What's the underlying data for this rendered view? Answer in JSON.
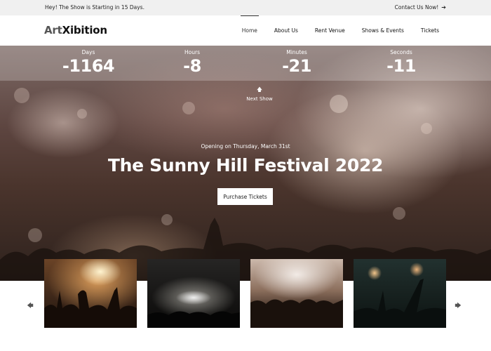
{
  "topbar": {
    "announcement": "Hey! The Show is Starting in 15 Days.",
    "contact_label": "Contact Us Now!",
    "contact_icon": "arrow-right-icon"
  },
  "header": {
    "logo_part1": "Art",
    "logo_part2": "Xibition",
    "nav": [
      {
        "label": "Home",
        "active": true
      },
      {
        "label": "About Us",
        "active": false
      },
      {
        "label": "Rent Venue",
        "active": false
      },
      {
        "label": "Shows & Events",
        "active": false
      },
      {
        "label": "Tickets",
        "active": false
      }
    ]
  },
  "countdown": [
    {
      "label": "Days",
      "value": "-1164"
    },
    {
      "label": "Hours",
      "value": "-8"
    },
    {
      "label": "Minutes",
      "value": "-21"
    },
    {
      "label": "Seconds",
      "value": "-11"
    }
  ],
  "hero": {
    "next_show_label": "Next Show",
    "next_show_icon": "arrow-up-icon",
    "opening_text": "Opening on Thursday, March 31st",
    "title": "The Sunny Hill Festival 2022",
    "cta_label": "Purchase Tickets"
  },
  "gallery": {
    "prev_icon": "arrow-left-icon",
    "next_icon": "arrow-right-icon",
    "items": [
      {
        "name": "concert-photo-1"
      },
      {
        "name": "concert-photo-2"
      },
      {
        "name": "concert-photo-3"
      },
      {
        "name": "concert-photo-4"
      }
    ]
  },
  "colors": {
    "topbar_bg": "#f0f0f0",
    "text_dark": "#111111",
    "hero_text": "#ffffff"
  }
}
